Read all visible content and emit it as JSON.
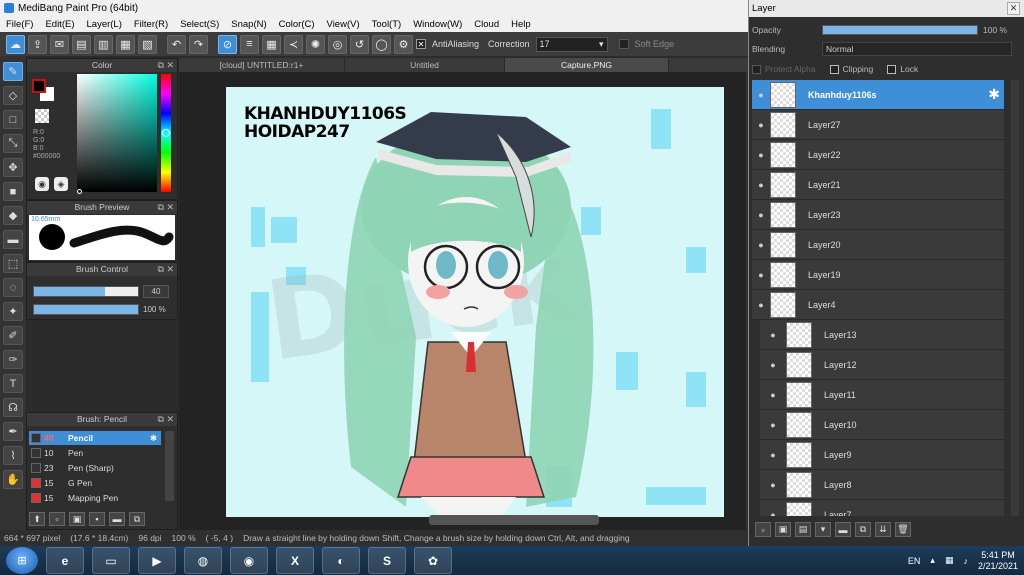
{
  "app": {
    "title": "MediBang Paint Pro (64bit)"
  },
  "menu": [
    "File(F)",
    "Edit(E)",
    "Layer(L)",
    "Filter(R)",
    "Select(S)",
    "Snap(N)",
    "Color(C)",
    "View(V)",
    "Tool(T)",
    "Window(W)",
    "Cloud",
    "Help"
  ],
  "toolbar": {
    "antialiasing_label": "AntiAliasing",
    "correction_label": "Correction",
    "correction_value": "17",
    "soft_edge_label": "Soft Edge"
  },
  "color_panel": {
    "title": "Color",
    "r": "R:0",
    "g": "G:0",
    "b": "B:0",
    "hex": "#000000"
  },
  "brush_preview": {
    "title": "Brush Preview",
    "size": "10.65mm"
  },
  "brush_control": {
    "title": "Brush Control",
    "size_value": "40",
    "opacity_value": "100 %",
    "size_fraction": 0.68,
    "opacity_fraction": 1.0
  },
  "brush_list": {
    "title": "Brush: Pencil",
    "items": [
      {
        "num": "40",
        "name": "Pencil",
        "color": "#333333",
        "selected": true
      },
      {
        "num": "10",
        "name": "Pen",
        "color": "#333333"
      },
      {
        "num": "23",
        "name": "Pen (Sharp)",
        "color": "#333333"
      },
      {
        "num": "15",
        "name": "G Pen",
        "color": "#e03030"
      },
      {
        "num": "15",
        "name": "Mapping Pen",
        "color": "#e03030"
      }
    ]
  },
  "tabs": [
    "[cloud] UNTITLED:r1+",
    "Untitled",
    "Capture.PNG"
  ],
  "canvas": {
    "line1": "KHANHDUY1106S",
    "line2": "HOIDAP247",
    "watermark": "Duck"
  },
  "status": {
    "size": "664 * 697 pixel",
    "dims": "(17.6 * 18.4cm)",
    "dpi": "96 dpi",
    "zoom": "100 %",
    "coords": "( -5, 4 )",
    "hint": "Draw a straight line by holding down Shift, Change a brush size by holding down Ctrl, Alt, and dragging"
  },
  "layer_panel": {
    "title": "Layer",
    "opacity_label": "Opacity",
    "opacity_value": "100 %",
    "blending_label": "Blending",
    "blending_value": "Normal",
    "protect_alpha": "Protect Alpha",
    "clipping": "Clipping",
    "lock": "Lock",
    "layers": [
      {
        "name": "Khanhduy1106s",
        "selected": true
      },
      {
        "name": "Layer27"
      },
      {
        "name": "Layer22"
      },
      {
        "name": "Layer21"
      },
      {
        "name": "Layer23"
      },
      {
        "name": "Layer20"
      },
      {
        "name": "Layer19"
      },
      {
        "name": "Layer4"
      },
      {
        "name": "Layer13",
        "sub": true
      },
      {
        "name": "Layer12",
        "sub": true
      },
      {
        "name": "Layer11",
        "sub": true
      },
      {
        "name": "Layer10",
        "sub": true
      },
      {
        "name": "Layer9",
        "sub": true
      },
      {
        "name": "Layer8",
        "sub": true
      },
      {
        "name": "Layer7",
        "sub": true
      }
    ]
  },
  "taskbar": {
    "lang": "EN",
    "time": "5:41 PM",
    "date": "2/21/2021"
  }
}
